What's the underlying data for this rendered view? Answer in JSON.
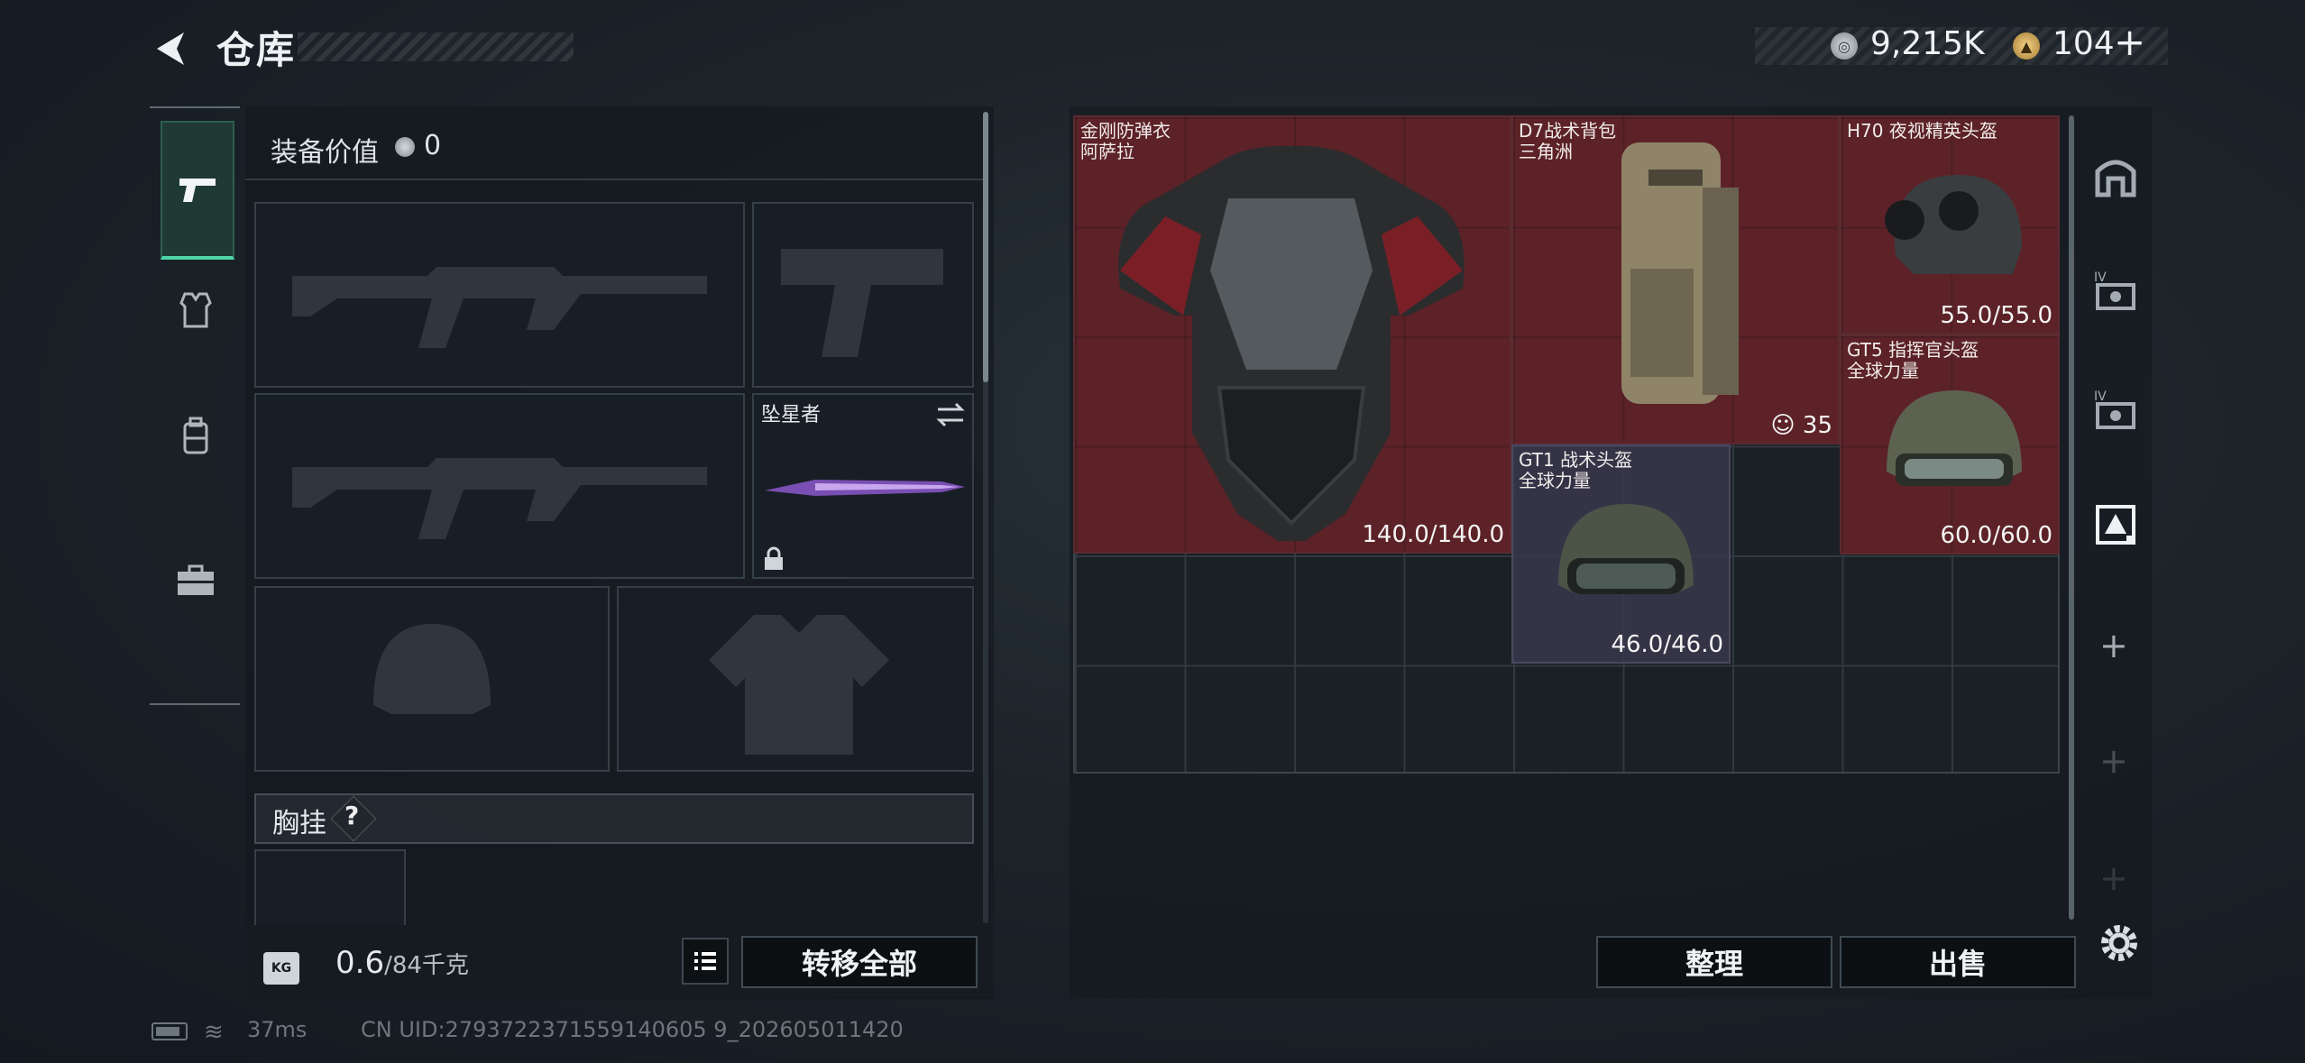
{
  "header": {
    "title": "仓库",
    "silver_amount": "9,215K",
    "gold_amount": "104",
    "gold_plus": "+"
  },
  "equipment": {
    "value_label": "装备价值",
    "value": "0",
    "melee_name": "坠星者",
    "chest_rig_label": "胸挂",
    "chest_rig_help": "?",
    "weight_current": "0.6",
    "weight_max": "/84千克",
    "weight_icon_text": "KG",
    "transfer_all_label": "转移全部"
  },
  "stash": {
    "items": [
      {
        "name": "金刚防弹衣\n阿萨拉",
        "durability": "140.0/140.0",
        "rarity": "red"
      },
      {
        "name": "D7战术背包\n三角洲",
        "count": "35",
        "rarity": "red"
      },
      {
        "name": "H70 夜视精英头盔",
        "durability": "55.0/55.0",
        "rarity": "red"
      },
      {
        "name": "GT5 指挥官头盔\n全球力量",
        "durability": "60.0/60.0",
        "rarity": "red"
      },
      {
        "name": "GT1 战术头盔\n全球力量",
        "durability": "46.0/46.0",
        "rarity": "purple"
      }
    ],
    "sort_label": "整理",
    "sell_label": "出售",
    "side_tabs": [
      "armor-slot",
      "armor-level-iv",
      "armor-level-iv",
      "container-tab"
    ]
  },
  "footer": {
    "ping": "37ms",
    "uid": "CN UID:2793722371559140605 9_202605011420"
  },
  "colors": {
    "accent": "#4fd4a8",
    "red_rarity": "#6e2228",
    "purple_rarity": "#3a384e"
  }
}
